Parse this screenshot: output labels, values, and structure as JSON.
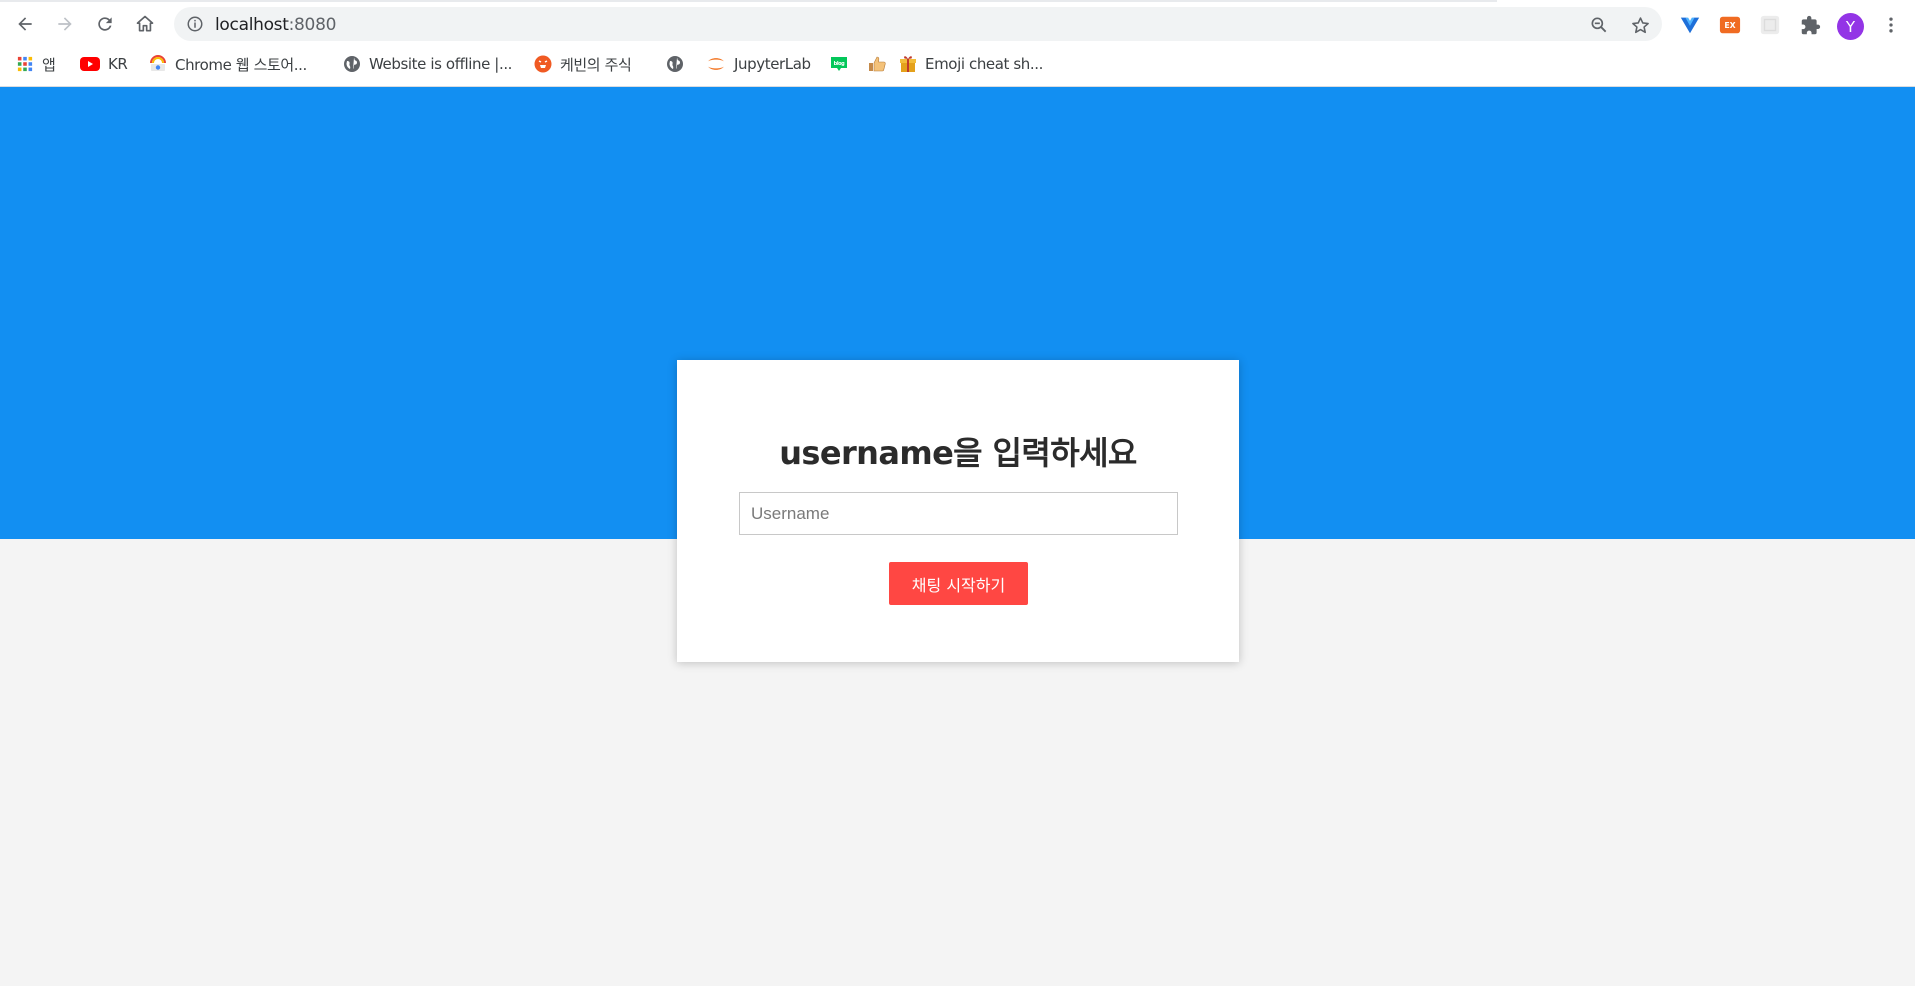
{
  "browser": {
    "url_host": "localhost",
    "url_port": ":8080",
    "avatar_initial": "Y",
    "bookmarks": [
      {
        "label": "앱",
        "icon": "apps-grid-icon"
      },
      {
        "label": "KR",
        "icon": "youtube-icon"
      },
      {
        "label": "Chrome 웹 스토어...",
        "icon": "chrome-web-store-icon"
      },
      {
        "label": "Website is offline |...",
        "icon": "globe-icon"
      },
      {
        "label": "케빈의 주식",
        "icon": "orange-site-icon"
      },
      {
        "label": "",
        "icon": "globe-icon"
      },
      {
        "label": "JupyterLab",
        "icon": "jupyter-icon"
      },
      {
        "label": "",
        "icon": "blog-icon"
      },
      {
        "label": "",
        "icon": "thumbs-up-icon"
      },
      {
        "label": "Emoji cheat sh...",
        "icon": "gift-icon"
      }
    ],
    "extensions": [
      "vue-devtools-icon",
      "ex-extension-icon",
      "blank-extension-icon",
      "puzzle-icon"
    ]
  },
  "login": {
    "heading": "username을 입력하세요",
    "input_placeholder": "Username",
    "input_value": "",
    "submit_label": "채팅 시작하기"
  },
  "colors": {
    "hero": "#128ff2",
    "button": "#ff4743",
    "background": "#f4f4f4"
  }
}
